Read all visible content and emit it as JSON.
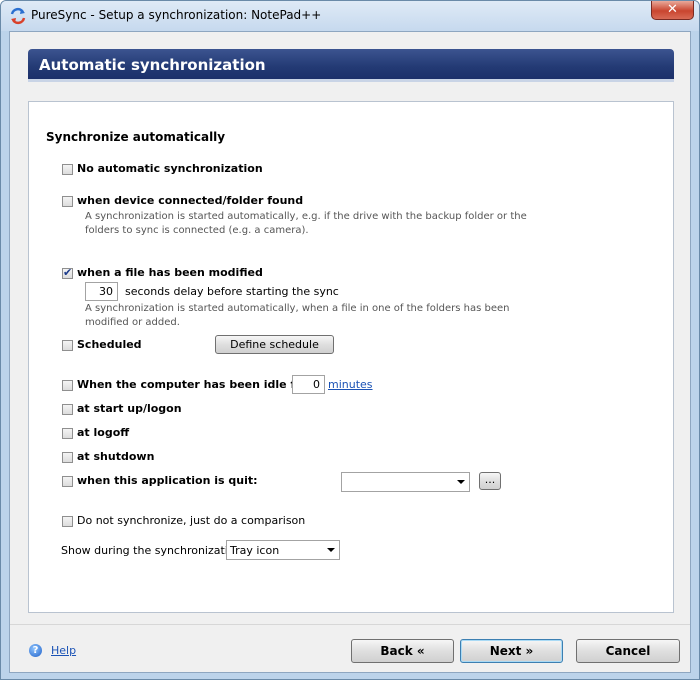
{
  "window": {
    "title": "PureSync - Setup a synchronization: NotePad++",
    "close_symbol": "✕",
    "icon": "puresync-app-icon"
  },
  "header": {
    "title": "Automatic synchronization"
  },
  "section": {
    "title": "Synchronize automatically"
  },
  "options": {
    "no_auto": {
      "label": "No automatic synchronization",
      "checked": false
    },
    "device_connected": {
      "label": "when device connected/folder found",
      "checked": false,
      "desc_line1": "A synchronization is started automatically, e.g. if the drive with the backup folder or the",
      "desc_line2": "folders to sync is connected (e.g. a camera)."
    },
    "file_modified": {
      "label": "when a file has been modified",
      "checked": true,
      "delay_value": "30",
      "delay_label": "seconds delay before starting the sync",
      "desc_line1": "A synchronization is started automatically, when a file in one of the folders has been",
      "desc_line2": "modified or added."
    },
    "scheduled": {
      "label": "Scheduled",
      "checked": false,
      "button_label": "Define schedule"
    },
    "idle": {
      "label": "When the computer has been idle for",
      "checked": false,
      "value": "0",
      "unit_link": "minutes"
    },
    "startup": {
      "label": "at start up/logon",
      "checked": false
    },
    "logoff": {
      "label": "at logoff",
      "checked": false
    },
    "shutdown": {
      "label": "at shutdown",
      "checked": false
    },
    "app_quit": {
      "label": "when this application is quit:",
      "checked": false,
      "selected": "",
      "browse_label": "..."
    },
    "compare_only": {
      "label": "Do not synchronize, just do a comparison",
      "checked": false
    }
  },
  "show_during": {
    "label": "Show during the synchronization:",
    "selected": "Tray icon"
  },
  "footer": {
    "help_label": "Help",
    "help_icon_glyph": "?",
    "back_label": "Back «",
    "next_label": "Next »",
    "cancel_label": "Cancel"
  },
  "colors": {
    "header_bg": "#233a74",
    "window_frame": "#bcd3ea",
    "close_button": "#c9452f",
    "link": "#1a52b5"
  }
}
